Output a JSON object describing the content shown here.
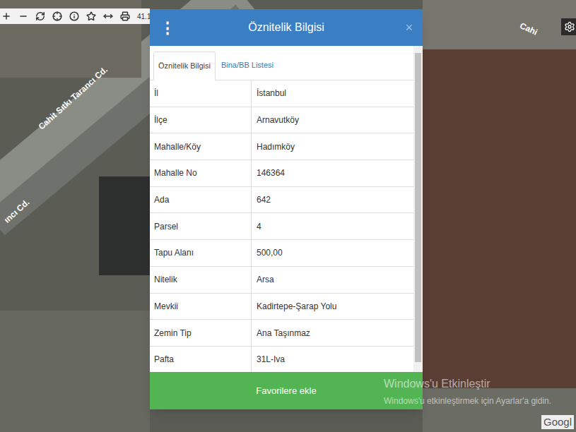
{
  "toolbar": {
    "coordinate": "41.1"
  },
  "map_labels": [
    {
      "text": "Cahit Sıtkı Tarancı Cd."
    },
    {
      "text": "ıncı Cd."
    },
    {
      "text": "Cahi"
    }
  ],
  "attribution": "Googl",
  "dialog": {
    "menu": "⋮",
    "title": "Öznitelik Bilgisi",
    "close": "×",
    "tabs": [
      {
        "label": "Öznitelik Bilgisi",
        "selected": true
      },
      {
        "label": "Bina/BB Listesi",
        "selected": false
      }
    ],
    "rows": [
      {
        "label": "İl",
        "value": "İstanbul"
      },
      {
        "label": "İlçe",
        "value": "Arnavutköy"
      },
      {
        "label": "Mahalle/Köy",
        "value": "Hadımköy"
      },
      {
        "label": "Mahalle No",
        "value": "146364"
      },
      {
        "label": "Ada",
        "value": "642"
      },
      {
        "label": "Parsel",
        "value": "4"
      },
      {
        "label": "Tapu Alanı",
        "value": "500,00"
      },
      {
        "label": "Nitelik",
        "value": "Arsa"
      },
      {
        "label": "Mevkii",
        "value": "Kadirtepe-Şarap Yolu"
      },
      {
        "label": "Zemin Tip",
        "value": "Ana Taşınmaz"
      },
      {
        "label": "Pafta",
        "value": "31L-Iva"
      }
    ],
    "button": "Favorilere ekle"
  },
  "watermark": {
    "title": "Windows'u Etkinleştir",
    "subtitle": "Windows'u etkinleştirmek için Ayarlar'a gidin."
  }
}
